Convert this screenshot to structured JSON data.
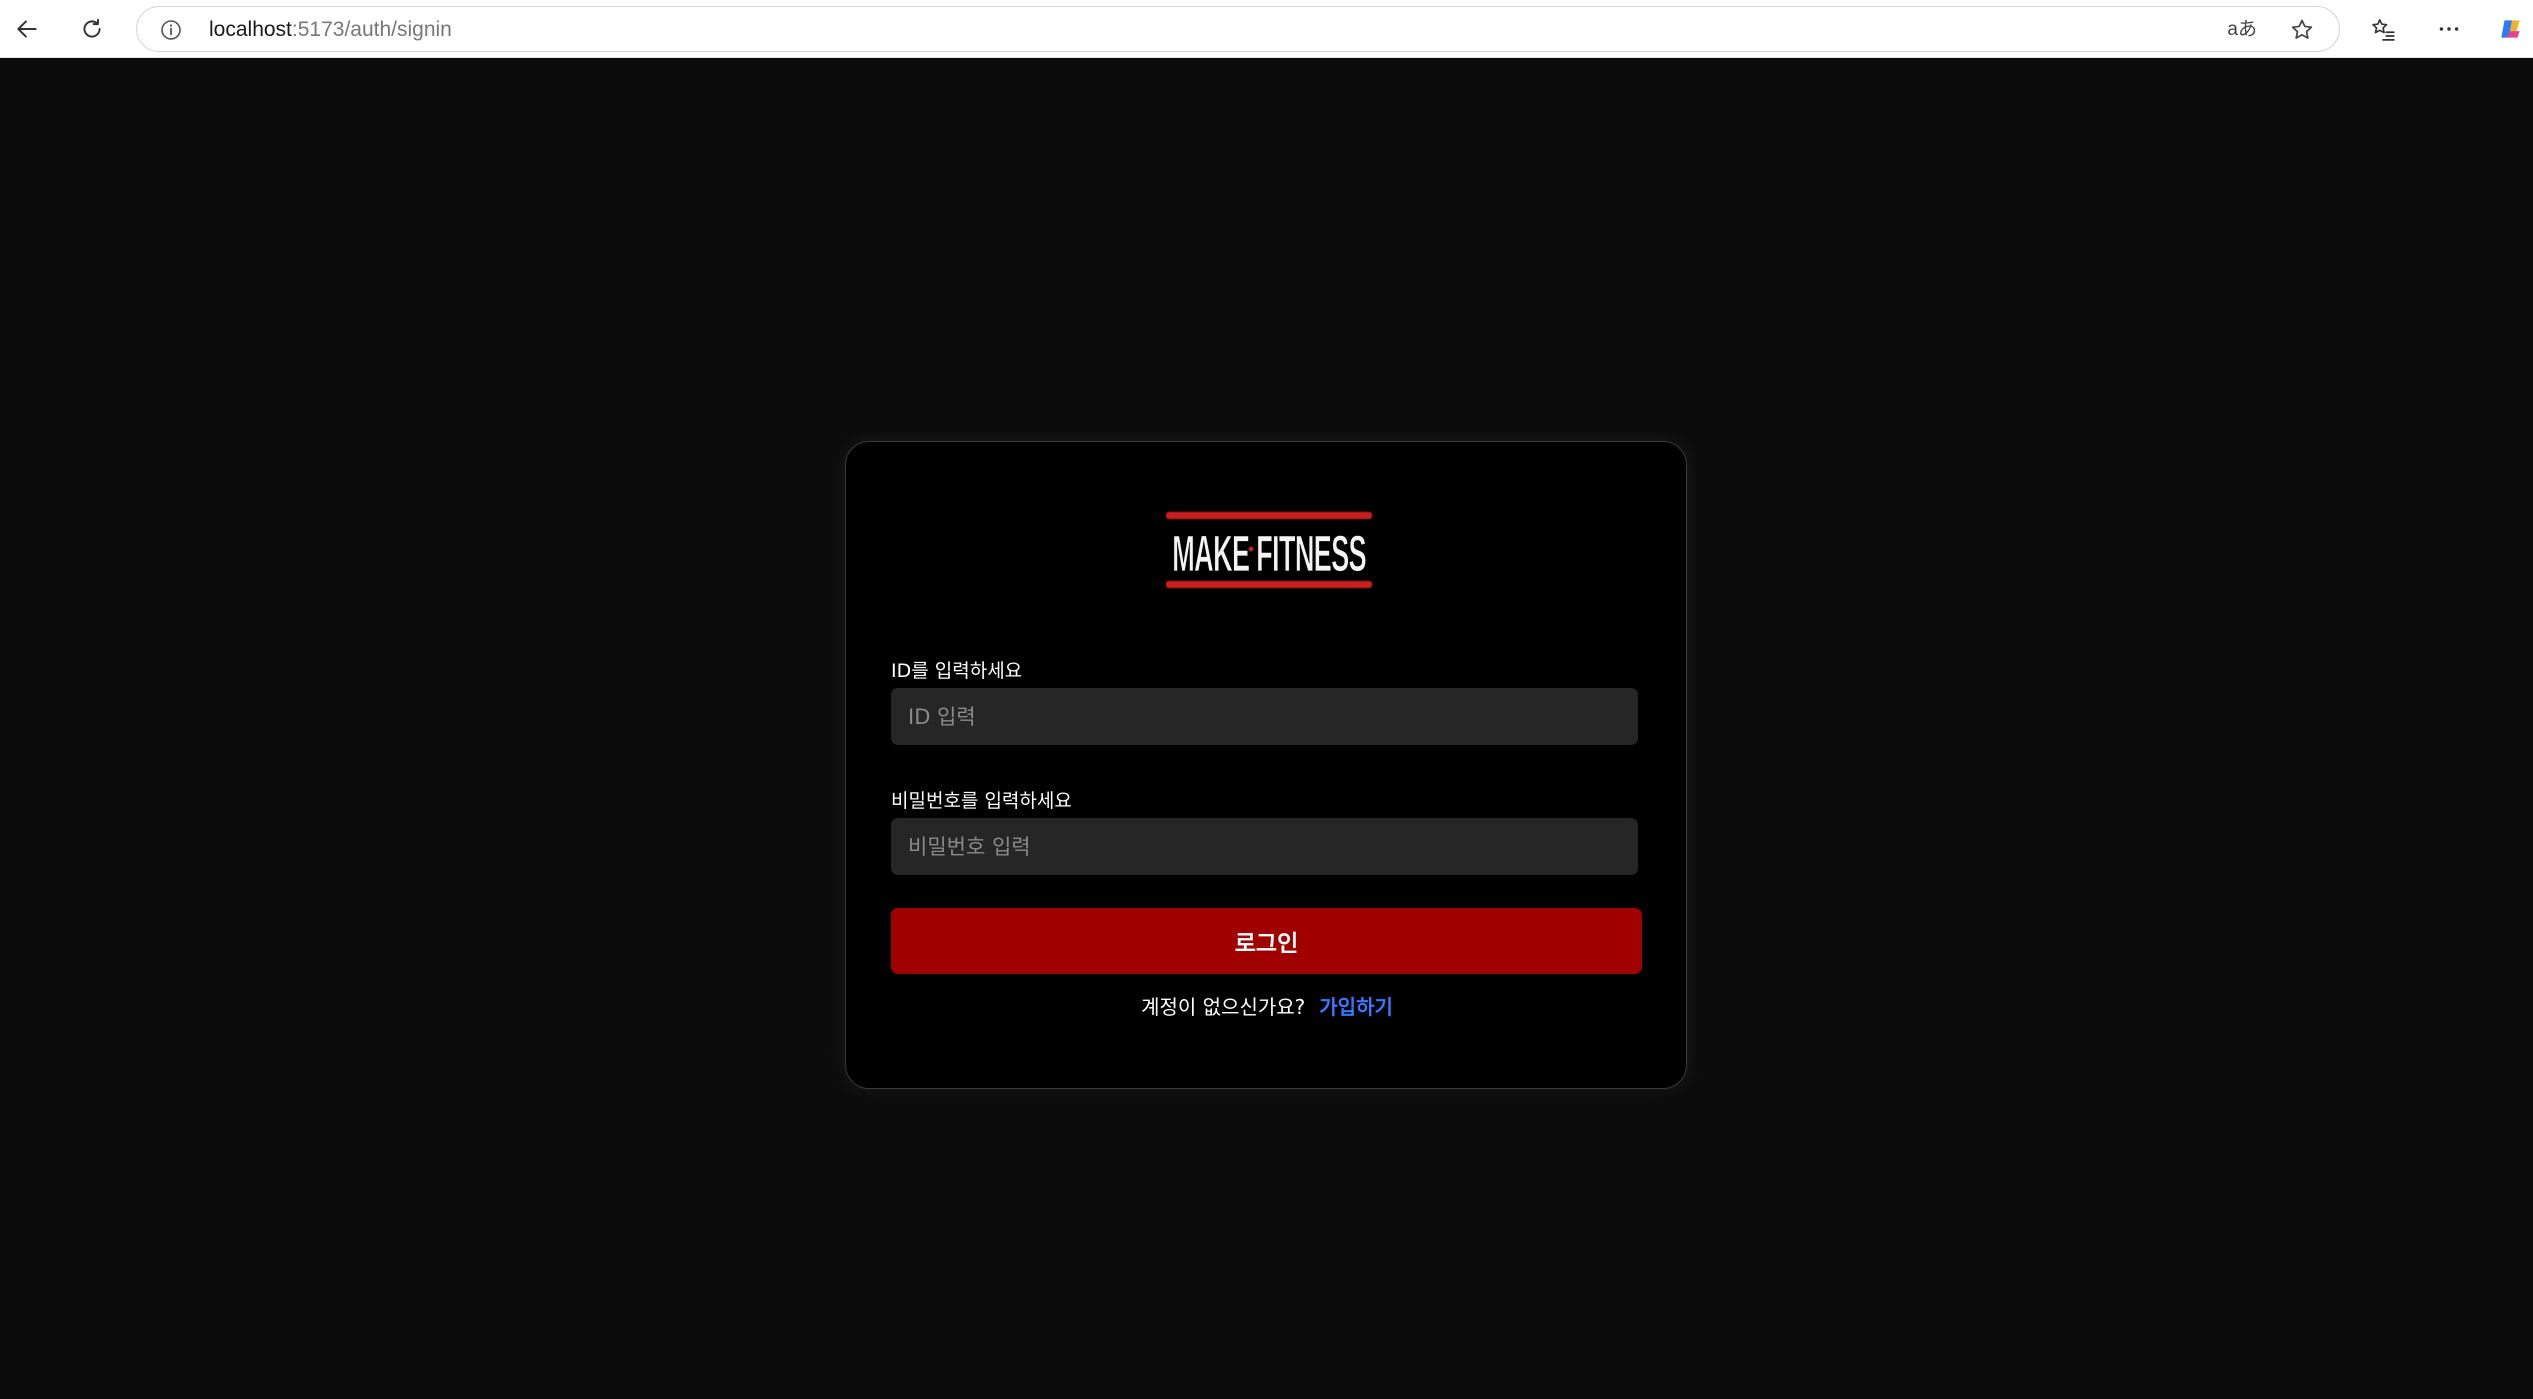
{
  "browser": {
    "url_host": "localhost",
    "url_path": ":5173/auth/signin",
    "translate_icon_text": "aあ",
    "icons": [
      "back-icon",
      "reload-icon",
      "site-info-icon",
      "translate-icon",
      "favorite-star-icon",
      "favorites-icon",
      "more-icon",
      "copilot-icon"
    ]
  },
  "login": {
    "logo_text": "MAKE·FITNESS",
    "id_label": "ID를 입력하세요",
    "id_placeholder": "ID 입력",
    "id_value": "",
    "password_label": "비밀번호를 입력하세요",
    "password_placeholder": "비밀번호 입력",
    "password_value": "",
    "submit_label": "로그인",
    "signup_prompt": "계정이 없으신가요?",
    "signup_link": "가입하기"
  },
  "colors": {
    "page_background": "#0b0b0b",
    "card_background": "#000000",
    "input_background": "#262626",
    "button_red": "#a00000",
    "link_blue": "#3a78ff",
    "logo_red": "#c8201e"
  }
}
